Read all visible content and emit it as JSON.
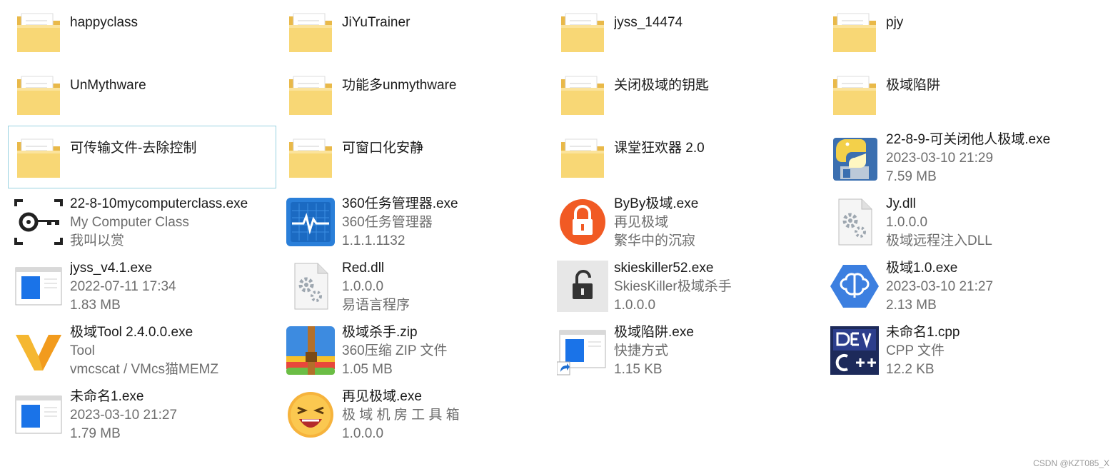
{
  "items": [
    {
      "name": "happyclass",
      "lines": [],
      "icon": "folder-icon"
    },
    {
      "name": "JiYuTrainer",
      "lines": [],
      "icon": "folder-icon"
    },
    {
      "name": "jyss_14474",
      "lines": [],
      "icon": "folder-icon"
    },
    {
      "name": "pjy",
      "lines": [],
      "icon": "folder-icon"
    },
    {
      "name": "UnMythware",
      "lines": [],
      "icon": "folder-icon"
    },
    {
      "name": "功能多unmythware",
      "lines": [],
      "icon": "folder-icon"
    },
    {
      "name": "关闭极域的钥匙",
      "lines": [],
      "icon": "folder-icon"
    },
    {
      "name": "极域陷阱",
      "lines": [],
      "icon": "folder-icon"
    },
    {
      "name": "可传输文件-去除控制",
      "lines": [],
      "icon": "folder-icon"
    },
    {
      "name": "可窗口化安静",
      "lines": [],
      "icon": "folder-icon"
    },
    {
      "name": "课堂狂欢器 2.0",
      "lines": [],
      "icon": "folder-icon"
    },
    {
      "name": "22-8-9-可关闭他人极域.exe",
      "lines": [
        "2023-03-10 21:29",
        "7.59 MB"
      ],
      "icon": "python-exe-icon"
    },
    {
      "name": "22-8-10mycomputerclass.exe",
      "lines": [
        "My Computer Class",
        "我叫以赏"
      ],
      "icon": "key-icon"
    },
    {
      "name": "360任务管理器.exe",
      "lines": [
        "360任务管理器",
        "1.1.1.1132"
      ],
      "icon": "task-manager-icon"
    },
    {
      "name": "ByBy极域.exe",
      "lines": [
        "再见极域",
        "繁华中的沉寂"
      ],
      "icon": "lock-icon"
    },
    {
      "name": "Jy.dll",
      "lines": [
        "1.0.0.0",
        "极域远程注入DLL"
      ],
      "icon": "dll-icon"
    },
    {
      "name": "jyss_v4.1.exe",
      "lines": [
        "2022-07-11 17:34",
        "1.83 MB"
      ],
      "icon": "window-exe-icon"
    },
    {
      "name": "Red.dll",
      "lines": [
        "1.0.0.0",
        "易语言程序"
      ],
      "icon": "dll-icon"
    },
    {
      "name": "skieskiller52.exe",
      "lines": [
        "SkiesKiller极域杀手",
        "1.0.0.0"
      ],
      "icon": "unlock-icon"
    },
    {
      "name": "极域1.0.exe",
      "lines": [
        "2023-03-10 21:27",
        "2.13 MB"
      ],
      "icon": "brain-icon"
    },
    {
      "name": "极域Tool 2.4.0.0.exe",
      "lines": [
        "Tool",
        "vmcscat / VMcs猫MEMZ"
      ],
      "icon": "v-logo-icon"
    },
    {
      "name": "极域杀手.zip",
      "lines": [
        "360压缩 ZIP 文件",
        "1.05 MB"
      ],
      "icon": "zip-icon"
    },
    {
      "name": "极域陷阱.exe",
      "lines": [
        "快捷方式",
        "1.15 KB"
      ],
      "icon": "shortcut-exe-icon"
    },
    {
      "name": "未命名1.cpp",
      "lines": [
        "CPP 文件",
        "12.2 KB"
      ],
      "icon": "devcpp-icon"
    },
    {
      "name": "未命名1.exe",
      "lines": [
        "2023-03-10 21:27",
        "1.79 MB"
      ],
      "icon": "window-exe-icon"
    },
    {
      "name": "再见极域.exe",
      "lines": [
        "极 域 机 房 工 具 箱",
        "1.0.0.0"
      ],
      "icon": "laughing-face-icon"
    }
  ],
  "selected_index": 8,
  "watermark": "CSDN @KZT085_X",
  "colors": {
    "selection_border": "#99d1e0",
    "folder": "#f8d775",
    "name_text": "#1a1a1a",
    "meta_text": "#6d6d6d"
  }
}
